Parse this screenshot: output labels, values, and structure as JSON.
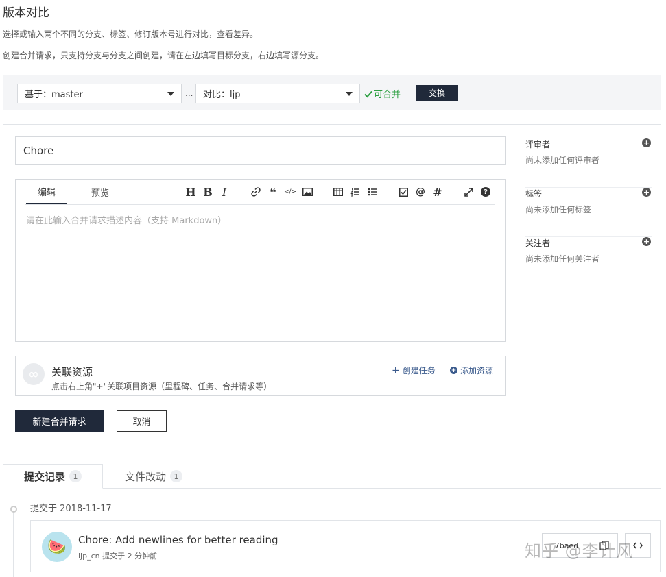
{
  "header": {
    "title": "版本对比",
    "desc1": "选择或输入两个不同的分支、标签、修订版本号进行对比，查看差异。",
    "desc2": "创建合并请求，只支持分支与分支之间创建，请在左边填写目标分支，右边填写源分支。"
  },
  "compare": {
    "base_label": "基于：master",
    "separator": "...",
    "compare_label": "对比：ljp",
    "mergeable": "可合并",
    "swap_label": "交换"
  },
  "form": {
    "title_value": "Chore",
    "tabs": [
      "编辑",
      "预览"
    ],
    "toolbar_icons": [
      "heading-icon",
      "bold-icon",
      "italic-icon",
      "link-icon",
      "quote-icon",
      "code-icon",
      "image-icon",
      "table-icon",
      "ordered-list-icon",
      "unordered-list-icon",
      "task-list-icon",
      "mention-icon",
      "hashtag-icon",
      "fullscreen-icon",
      "help-icon"
    ],
    "toolbar_glyphs": {
      "h": "H",
      "b": "B",
      "i": "I",
      "quote": "❝",
      "code": "</>",
      "at": "@",
      "hash": "#",
      "help": "?"
    },
    "placeholder": "请在此输入合并请求描述内容（支持 Markdown）",
    "related": {
      "title": "关联资源",
      "hint": "点击右上角\"+\"关联项目资源（里程碑、任务、合并请求等）",
      "create_task": "创建任务",
      "add_resource": "添加资源",
      "icon_glyph": "∞"
    },
    "submit_label": "新建合并请求",
    "cancel_label": "取消"
  },
  "sidebar": {
    "sections": [
      {
        "title": "评审者",
        "empty": "尚未添加任何评审者"
      },
      {
        "title": "标签",
        "empty": "尚未添加任何标签"
      },
      {
        "title": "关注者",
        "empty": "尚未添加任何关注者"
      }
    ],
    "plus_glyph": "+"
  },
  "commits_tabs": [
    {
      "label": "提交记录",
      "count": "1"
    },
    {
      "label": "文件改动",
      "count": "1"
    }
  ],
  "commit_group": {
    "date_label": "提交于 2018-11-17",
    "commit": {
      "message": "Chore: Add newlines for better reading",
      "meta": "ljp_cn 提交于 2 分钟前",
      "sha": "7baed",
      "avatar_glyph": "🍉"
    }
  },
  "watermark": "知乎 @李计风",
  "colors": {
    "primary": "#20293a",
    "success": "#2ea043",
    "link": "#3a5a8c",
    "border": "#e1e4e8"
  }
}
